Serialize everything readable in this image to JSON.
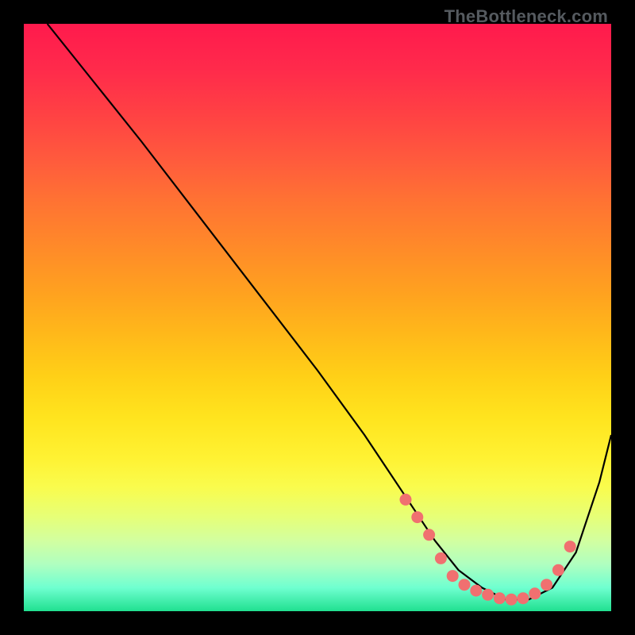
{
  "watermark": "TheBottleneck.com",
  "chart_data": {
    "type": "line",
    "title": "",
    "xlabel": "",
    "ylabel": "",
    "xlim": [
      0,
      100
    ],
    "ylim": [
      0,
      100
    ],
    "series": [
      {
        "name": "curve",
        "x": [
          4,
          8,
          12,
          20,
          30,
          40,
          50,
          58,
          62,
          66,
          70,
          74,
          78,
          82,
          86,
          90,
          94,
          98,
          100
        ],
        "y": [
          100,
          95,
          90,
          80,
          67,
          54,
          41,
          30,
          24,
          18,
          12,
          7,
          4,
          2,
          2,
          4,
          10,
          22,
          30
        ]
      }
    ],
    "markers": {
      "name": "highlight-dots",
      "color": "#f07070",
      "points": [
        {
          "x": 65,
          "y": 19
        },
        {
          "x": 67,
          "y": 16
        },
        {
          "x": 69,
          "y": 13
        },
        {
          "x": 71,
          "y": 9
        },
        {
          "x": 73,
          "y": 6
        },
        {
          "x": 75,
          "y": 4.5
        },
        {
          "x": 77,
          "y": 3.5
        },
        {
          "x": 79,
          "y": 2.8
        },
        {
          "x": 81,
          "y": 2.2
        },
        {
          "x": 83,
          "y": 2.0
        },
        {
          "x": 85,
          "y": 2.2
        },
        {
          "x": 87,
          "y": 3.0
        },
        {
          "x": 89,
          "y": 4.5
        },
        {
          "x": 91,
          "y": 7.0
        },
        {
          "x": 93,
          "y": 11.0
        }
      ]
    }
  }
}
